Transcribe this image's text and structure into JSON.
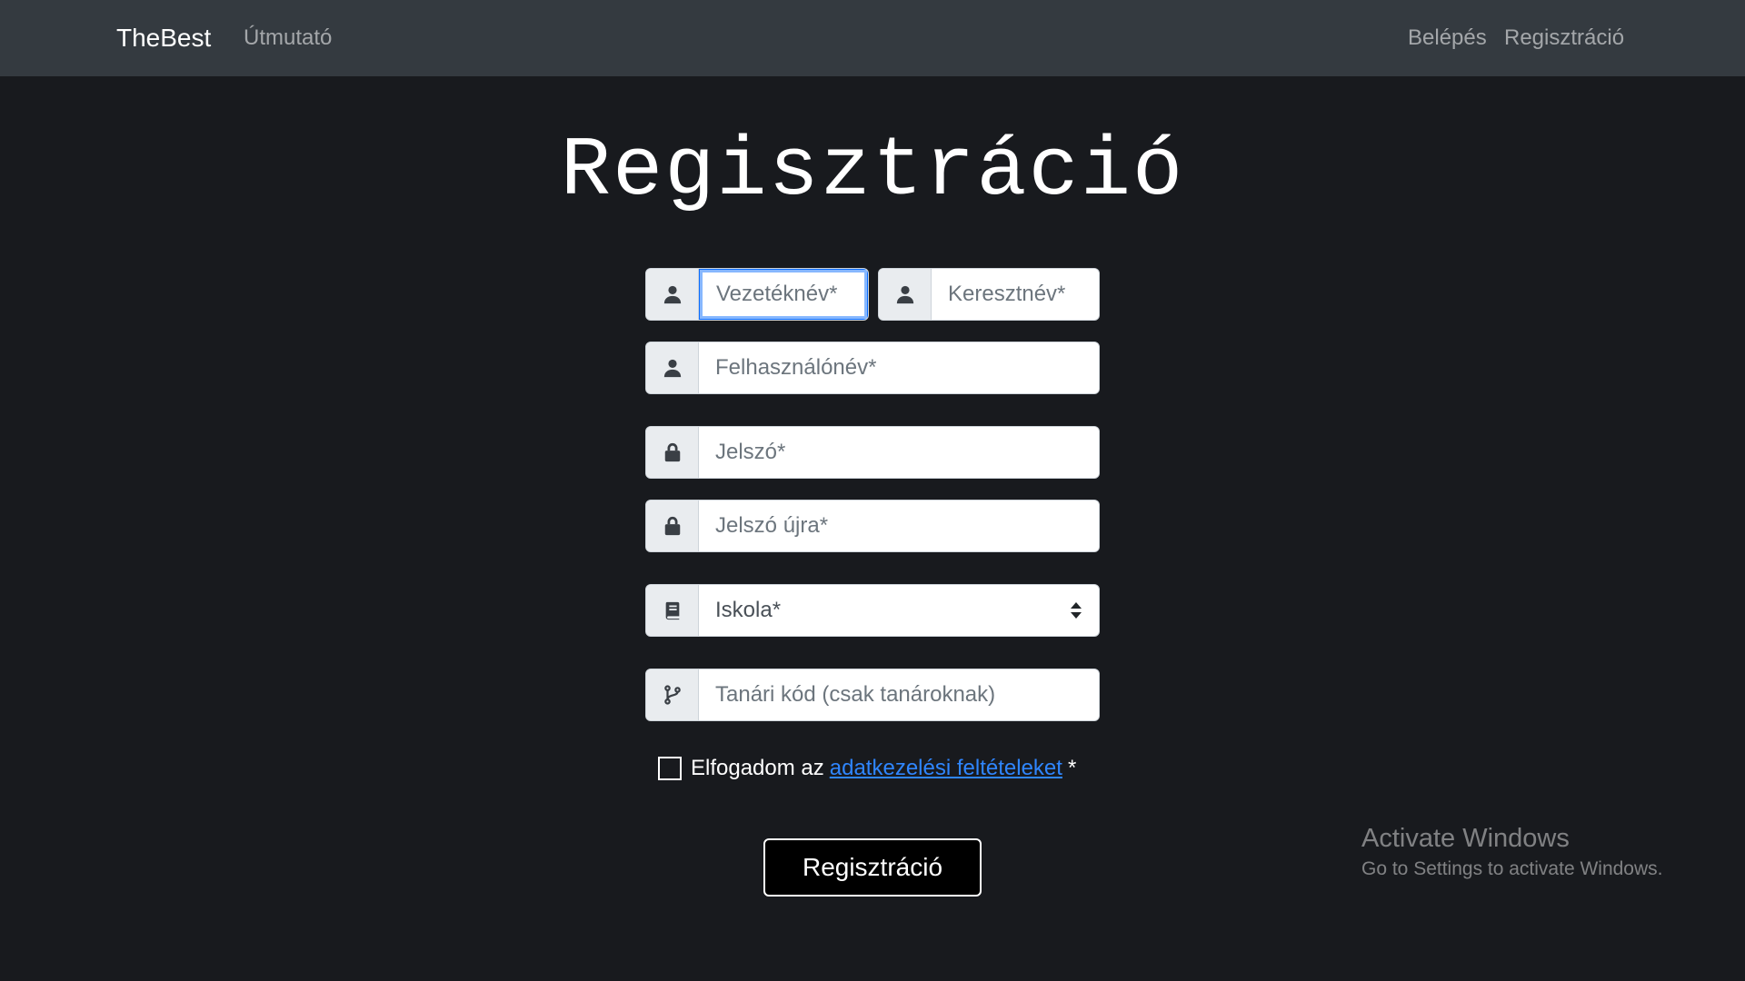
{
  "navbar": {
    "brand": "TheBest",
    "guide": "Útmutató",
    "login": "Belépés",
    "register": "Regisztráció",
    "background": "#343a40"
  },
  "page": {
    "title": "Regisztráció",
    "background": "#181a1e"
  },
  "form": {
    "last_name": {
      "placeholder": "Vezetéknév*",
      "value": "",
      "icon": "user-icon",
      "focused": true
    },
    "first_name": {
      "placeholder": "Keresztnév*",
      "value": "",
      "icon": "user-icon"
    },
    "username": {
      "placeholder": "Felhasználónév*",
      "value": "",
      "icon": "user-icon"
    },
    "password": {
      "placeholder": "Jelszó*",
      "value": "",
      "icon": "lock-icon"
    },
    "password_again": {
      "placeholder": "Jelszó újra*",
      "value": "",
      "icon": "lock-icon"
    },
    "school": {
      "selected": "Iskola*",
      "icon": "book-icon"
    },
    "teacher_code": {
      "placeholder": "Tanári kód (csak tanároknak)",
      "value": "",
      "icon": "code-branch-icon"
    },
    "terms": {
      "prefix": "Elfogadom az",
      "link": "adatkezelési feltételeket",
      "suffix": "*",
      "checked": false,
      "link_color": "#2f86ff"
    },
    "submit_label": "Regisztráció"
  },
  "watermark": {
    "title": "Activate Windows",
    "subtitle": "Go to Settings to activate Windows."
  }
}
